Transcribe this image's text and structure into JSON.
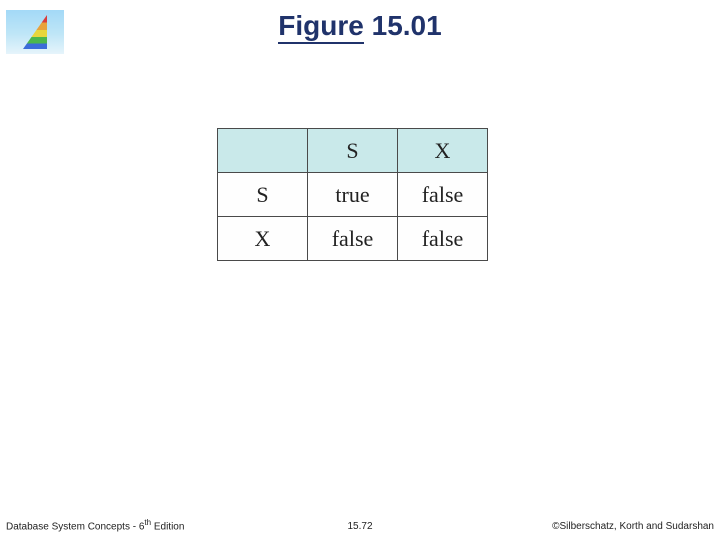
{
  "title": {
    "prefix": "Figure",
    "rest": " 15.01"
  },
  "table": {
    "col_headers": [
      "S",
      "X"
    ],
    "row_headers": [
      "S",
      "X"
    ],
    "cells": [
      [
        "true",
        "false"
      ],
      [
        "false",
        "false"
      ]
    ]
  },
  "footer": {
    "left_prefix": "Database System Concepts - 6",
    "left_sup": "th",
    "left_suffix": " Edition",
    "center": "15.72",
    "right": "©Silberschatz, Korth and Sudarshan"
  },
  "chart_data": {
    "type": "table",
    "title": "Figure 15.01",
    "columns": [
      "",
      "S",
      "X"
    ],
    "rows": [
      [
        "S",
        "true",
        "false"
      ],
      [
        "X",
        "false",
        "false"
      ]
    ]
  }
}
